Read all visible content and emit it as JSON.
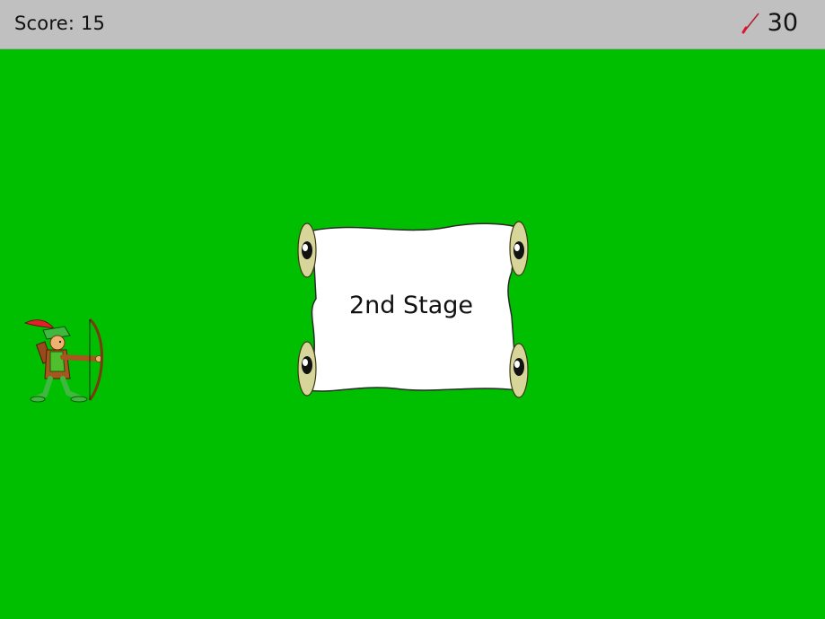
{
  "hud": {
    "score_text": "Score: 15",
    "arrows_left": "30",
    "arrow_icon": "arrow-icon"
  },
  "stage_banner": {
    "text": "2nd Stage"
  },
  "colors": {
    "field": "#00bf00",
    "hud_bar": "#c0c0c0",
    "scroll_paper": "#ffffff",
    "scroll_roll": "#d8d59a",
    "arrow_tip": "#e0102a"
  }
}
